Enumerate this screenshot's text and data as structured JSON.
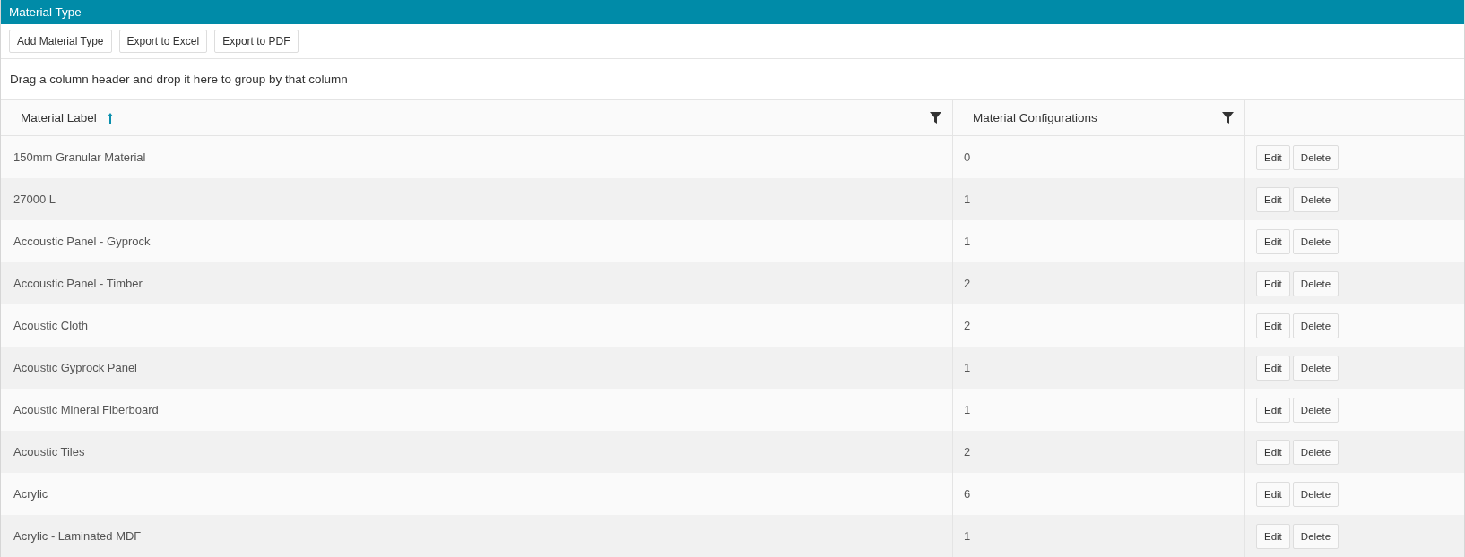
{
  "panel": {
    "title": "Material Type"
  },
  "toolbar": {
    "buttons": [
      "Add Material Type",
      "Export to Excel",
      "Export to PDF"
    ]
  },
  "group_panel": {
    "hint": "Drag a column header and drop it here to group by that column"
  },
  "table": {
    "columns": [
      {
        "label": "Material Label",
        "sorted_ascending": true,
        "filterable": true
      },
      {
        "label": "Material Configurations",
        "sorted_ascending": false,
        "filterable": true
      }
    ],
    "rows": [
      {
        "label": "150mm Granular Material",
        "configurations": "0",
        "actions": [
          "Edit",
          "Delete"
        ]
      },
      {
        "label": "27000 L",
        "configurations": "1",
        "actions": [
          "Edit",
          "Delete"
        ]
      },
      {
        "label": "Accoustic Panel - Gyprock",
        "configurations": "1",
        "actions": [
          "Edit",
          "Delete"
        ]
      },
      {
        "label": "Accoustic Panel - Timber",
        "configurations": "2",
        "actions": [
          "Edit",
          "Delete"
        ]
      },
      {
        "label": "Acoustic Cloth",
        "configurations": "2",
        "actions": [
          "Edit",
          "Delete"
        ]
      },
      {
        "label": "Acoustic Gyprock Panel",
        "configurations": "1",
        "actions": [
          "Edit",
          "Delete"
        ]
      },
      {
        "label": "Acoustic Mineral Fiberboard",
        "configurations": "1",
        "actions": [
          "Edit",
          "Delete"
        ]
      },
      {
        "label": "Acoustic Tiles",
        "configurations": "2",
        "actions": [
          "Edit",
          "Delete"
        ]
      },
      {
        "label": "Acrylic",
        "configurations": "6",
        "actions": [
          "Edit",
          "Delete"
        ]
      },
      {
        "label": "Acrylic - Laminated MDF",
        "configurations": "1",
        "actions": [
          "Edit",
          "Delete"
        ]
      }
    ]
  }
}
